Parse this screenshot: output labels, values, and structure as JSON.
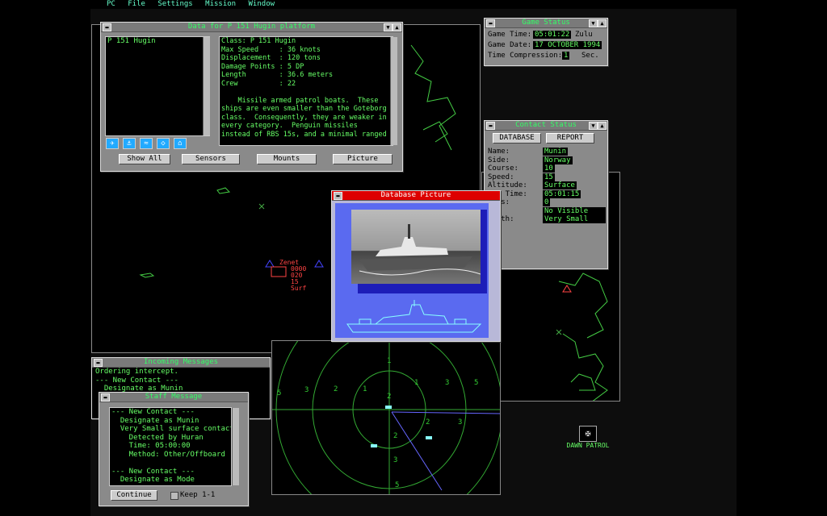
{
  "menu": [
    "PC",
    "File",
    "Settings",
    "Mission",
    "Window"
  ],
  "data_window": {
    "title": "Data for P 151 Hugin platform",
    "list": [
      "P 151 Hugin"
    ],
    "info": [
      "Class: P 151 Hugin",
      "Max Speed     : 36 knots",
      "Displacement  : 120 tons",
      "Damage Points : 5 DP",
      "Length        : 36.6 meters",
      "Crew          : 22",
      "",
      "    Missile armed patrol boats.  These",
      "ships are even smaller than the Goteborg",
      "class.  Consequently, they are weaker in",
      "every category.  Penguin missiles",
      "instead of RBS 15s, and a minimal ranged"
    ],
    "buttons": [
      "Show All",
      "Sensors",
      "Mounts",
      "Picture"
    ]
  },
  "game_status": {
    "title": "Game Status",
    "time_label": "Game Time:",
    "time_value": "05:01:22",
    "zone": "Zulu",
    "date_label": "Game Date:",
    "date_value": "17 OCTOBER 1994",
    "comp_label": "Time Compression:",
    "comp_value": "1",
    "comp_unit": "Sec."
  },
  "contact_status": {
    "title": "Contact Status",
    "btn_db": "DATABASE",
    "btn_report": "REPORT",
    "rows": [
      {
        "label": "Name:",
        "value": "Munin"
      },
      {
        "label": "Side:",
        "value": "Norway"
      },
      {
        "label": "Course:",
        "value": "10"
      },
      {
        "label": "Speed:",
        "value": "15"
      },
      {
        "label": "Altitude:",
        "value": "Surface"
      },
      {
        "label": "ect Time:",
        "value": "05:01:15"
      },
      {
        "label": " Msls:",
        "value": "0"
      },
      {
        "label": "",
        "value": "No Visible Damag"
      },
      {
        "label": "ength:",
        "value": "Very Small"
      }
    ]
  },
  "db_picture": {
    "title": "Database Picture"
  },
  "incoming": {
    "title": "Incoming Messages",
    "lines": [
      "Ordering intercept.",
      "--- New Contact ---",
      "  Designate as Munin"
    ]
  },
  "staff": {
    "title": "Staff Message",
    "lines": [
      "--- New Contact ---",
      "  Designate as Munin",
      "  Very Small surface contact.",
      "    Detected by Huran",
      "    Time: 05:00:00",
      "    Method: Other/Offboard",
      "",
      "--- New Contact ---",
      "  Designate as Mode"
    ],
    "continue": "Continue",
    "keep": "Keep 1-1"
  },
  "map_contact": {
    "name": "Zenet",
    "line1": "0000",
    "line2": "020",
    "line3": "15",
    "line4": "Surf"
  },
  "radar_labels": [
    "1",
    "2",
    "3",
    "5",
    "1",
    "2",
    "3",
    "5",
    "1",
    "2",
    "3",
    "2",
    "3",
    "5"
  ],
  "desktop_icon": {
    "label": "DAWN PATROL",
    "icon": "patrol-icon"
  }
}
